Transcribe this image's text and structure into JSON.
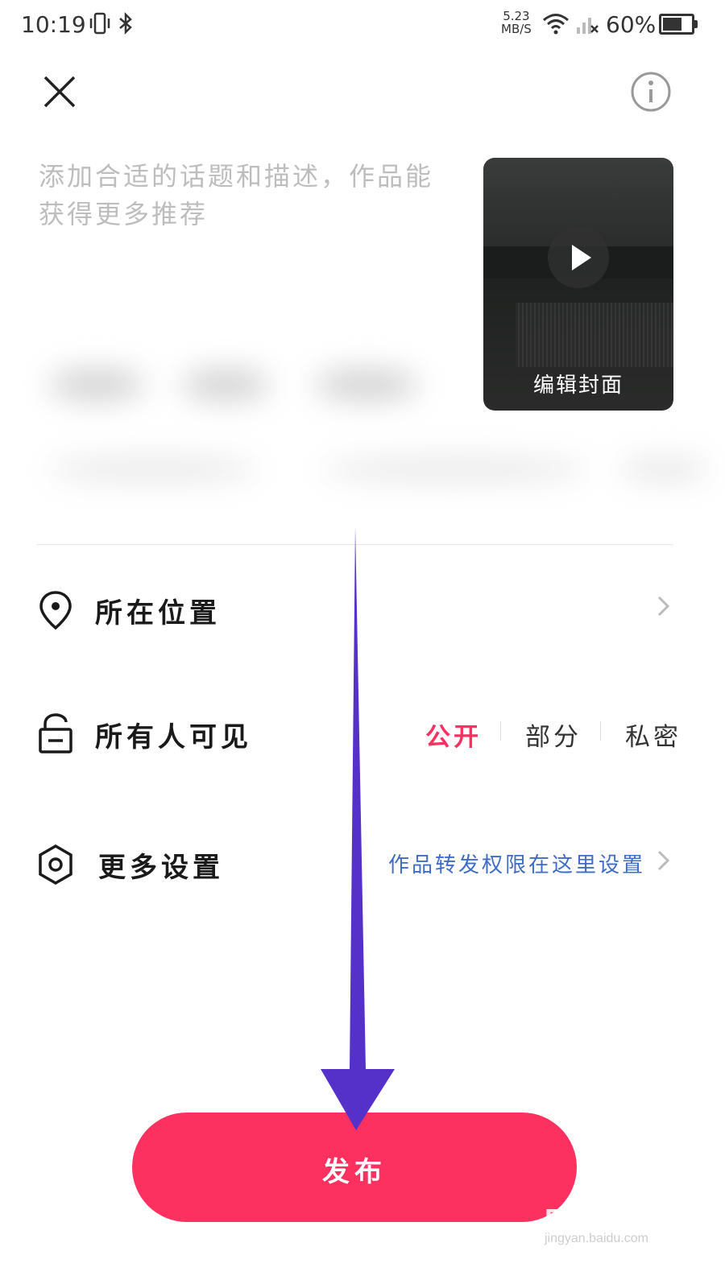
{
  "status_bar": {
    "time": "10:19",
    "net_speed_value": "5.23",
    "net_speed_unit": "MB/S",
    "battery": "60%"
  },
  "description": {
    "placeholder": "添加合适的话题和描述，作品能获得更多推荐"
  },
  "cover": {
    "edit_label": "编辑封面"
  },
  "location": {
    "label": "所在位置"
  },
  "visibility": {
    "label": "所有人可见",
    "options": [
      "公开",
      "部分",
      "私密"
    ],
    "selected": "公开",
    "active_color": "#fd3160"
  },
  "more_settings": {
    "label": "更多设置",
    "hint": "作品转发权限在这里设置"
  },
  "publish": {
    "label": "发布",
    "color": "#fd3160"
  },
  "annotation": {
    "arrow_color": "#5530c9"
  },
  "watermark": {
    "brand": "Bai度经验",
    "url": "jingyan.baidu.com"
  }
}
